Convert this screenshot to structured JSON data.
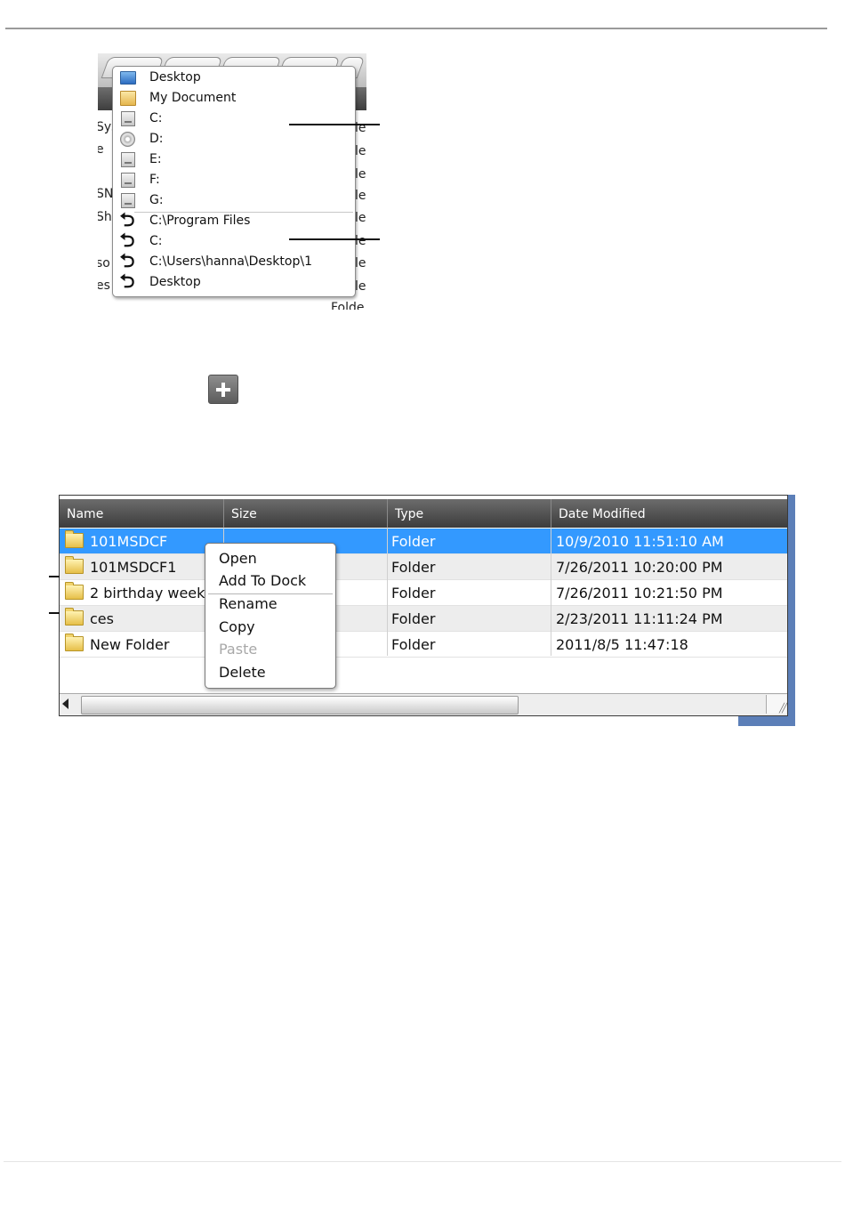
{
  "location_menu": {
    "background_fragments": [
      "Sys",
      "e",
      "SN",
      "Sh",
      "so",
      "es",
      "le",
      "Folde"
    ],
    "items": [
      {
        "label": "Desktop",
        "icon": "desktop-icon"
      },
      {
        "label": "My Document",
        "icon": "my-document-icon"
      },
      {
        "label": "C:",
        "icon": "drive-icon"
      },
      {
        "label": "D:",
        "icon": "cd-drive-icon"
      },
      {
        "label": "E:",
        "icon": "drive-icon"
      },
      {
        "label": "F:",
        "icon": "drive-icon"
      },
      {
        "label": "G:",
        "icon": "drive-icon"
      }
    ],
    "history": [
      {
        "label": "C:\\Program Files",
        "icon": "back-arrow-icon"
      },
      {
        "label": "C:",
        "icon": "back-arrow-icon"
      },
      {
        "label": "C:\\Users\\hanna\\Desktop\\1",
        "icon": "back-arrow-icon"
      },
      {
        "label": "Desktop",
        "icon": "back-arrow-icon"
      }
    ]
  },
  "add_button": {
    "icon": "plus-icon"
  },
  "file_list": {
    "columns": [
      "Name",
      "Size",
      "Type",
      "Date Modified"
    ],
    "rows": [
      {
        "name": "101MSDCF",
        "size": "",
        "type": "Folder",
        "date": "10/9/2010 11:51:10 AM",
        "selected": true
      },
      {
        "name": "101MSDCF1",
        "size": "",
        "type": "Folder",
        "date": "7/26/2011 10:20:00 PM"
      },
      {
        "name": "2 birthday week",
        "size": "",
        "type": "Folder",
        "date": "7/26/2011 10:21:50 PM"
      },
      {
        "name": "ces",
        "size": "",
        "type": "Folder",
        "date": "2/23/2011 11:11:24 PM"
      },
      {
        "name": "New Folder",
        "size": "",
        "type": "Folder",
        "date": "2011/8/5 11:47:18"
      }
    ],
    "selection_color": "#3399ff"
  },
  "context_menu": {
    "items": [
      {
        "label": "Open",
        "enabled": true
      },
      {
        "label": "Add To Dock",
        "enabled": true
      },
      {
        "label": "Rename",
        "enabled": true
      },
      {
        "label": "Copy",
        "enabled": true
      },
      {
        "label": "Paste",
        "enabled": false
      },
      {
        "label": "Delete",
        "enabled": true
      }
    ]
  }
}
